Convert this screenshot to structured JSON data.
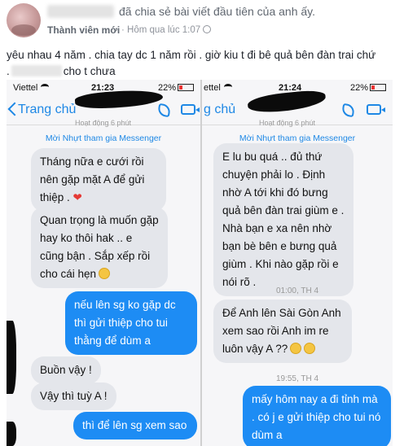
{
  "post": {
    "share_text": "đã chia sẻ bài viết đầu tiên của anh ấy.",
    "badge": "Thành viên mới",
    "time": "· Hôm qua lúc 1:07",
    "line1": "yêu nhau 4 năm . chia tay dc 1 năm rồi . giờ kiu t đi bê quả bên đàn trai chứ",
    "line2_prefix": ".",
    "line2_suffix": "cho t chưa"
  },
  "left_phone": {
    "carrier": "Viettel",
    "clock": "21:23",
    "battery": "22%",
    "nav_title": "Trang chủ",
    "active_sub": "Hoạt động 6 phút",
    "invite_link": "Mời Nhựt tham gia Messenger",
    "messages": [
      {
        "dir": "in",
        "text": "Tháng nữa e cưới rồi nên gặp mặt A để gửi thiệp ."
      },
      {
        "dir": "in",
        "text": "Quan trọng là muốn gặp hay ko thôi hak .. e cũng bận . Sắp xếp rồi cho cái hẹn"
      },
      {
        "dir": "out",
        "text": "nếu lên sg ko gặp dc thì gửi thiệp cho tui thằng để dùm a"
      },
      {
        "dir": "in",
        "text": "Buồn vậy !"
      },
      {
        "dir": "in",
        "text": "Vậy thì tuỳ A !"
      },
      {
        "dir": "out",
        "text": "thì để lên sg xem sao"
      }
    ]
  },
  "right_phone": {
    "carrier": "ettel",
    "clock": "21:24",
    "battery": "22%",
    "nav_title": "g chủ",
    "active_sub": "Hoạt động 6 phút",
    "invite_link": "Mời Nhựt tham gia Messenger",
    "messages": [
      {
        "dir": "in",
        "text": "E lu bu quá .. đủ thứ chuyện phải lo . Định nhờ A tới khi đó bưng quả bên đàn trai giùm e . Nhà bạn e xa nên nhờ bạn bè bên e bưng quả giùm . Khi nào gặp rồi e nói rõ ."
      },
      {
        "dir": "in",
        "text": "Để Anh lên Sài Gòn Anh xem sao rồi Anh im re luôn vậy A ??"
      },
      {
        "dir": "out",
        "text": "mấy hôm nay a đi tỉnh mà . có j e gửi thiệp cho tui nó dùm a"
      }
    ],
    "time_seps": [
      "01:00, TH 4",
      "19:55, TH 4"
    ]
  },
  "colors": {
    "messenger_blue": "#1d8cf4",
    "incoming_bubble": "#e4e6eb"
  }
}
